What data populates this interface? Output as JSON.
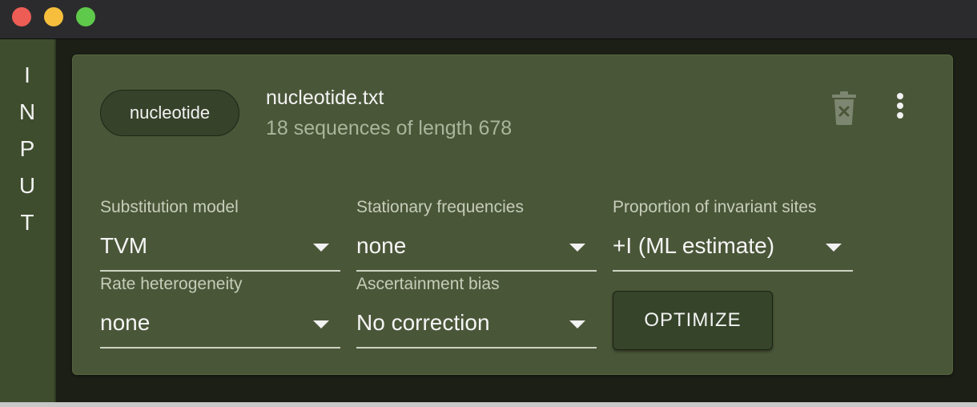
{
  "sidebar": {
    "label": "INPUT"
  },
  "file": {
    "type_chip": "nucleotide",
    "name": "nucleotide.txt",
    "info": "18 sequences of length 678"
  },
  "icons": {
    "delete": "trash-icon",
    "more": "more-vertical-icon"
  },
  "fields": {
    "substitution_model": {
      "label": "Substitution model",
      "value": "TVM"
    },
    "stationary_frequencies": {
      "label": "Stationary frequencies",
      "value": "none"
    },
    "invariant_sites": {
      "label": "Proportion of invariant sites",
      "value": "+I (ML estimate)"
    },
    "rate_heterogeneity": {
      "label": "Rate heterogeneity",
      "value": "none"
    },
    "ascertainment_bias": {
      "label": "Ascertainment bias",
      "value": "No correction"
    }
  },
  "actions": {
    "optimize_label": "OPTIMIZE"
  },
  "colors": {
    "card": "#4a5638",
    "sidebar": "#3e4d2d",
    "chip": "#36422a",
    "button": "#36442a"
  }
}
